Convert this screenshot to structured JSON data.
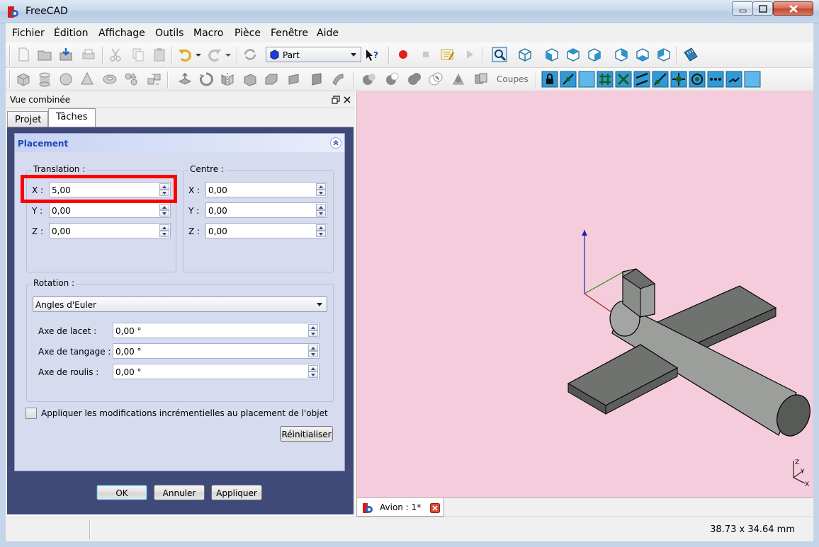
{
  "window": {
    "title": "FreeCAD",
    "icon": "freecad-gear-icon"
  },
  "menu": [
    "Fichier",
    "Édition",
    "Affichage",
    "Outils",
    "Macro",
    "Pièce",
    "Fenêtre",
    "Aide"
  ],
  "toolbar": {
    "workbench_selected": "Part",
    "sections_label": "Coupes"
  },
  "panel": {
    "title": "Vue combinée",
    "tabs": [
      "Projet",
      "Tâches"
    ],
    "active_tab": "Tâches"
  },
  "placement": {
    "title": "Placement",
    "translation": {
      "title": "Translation :",
      "x_label": "X :",
      "x_value": "5,00",
      "y_label": "Y :",
      "y_value": "0,00",
      "z_label": "Z :",
      "z_value": "0,00"
    },
    "centre": {
      "title": "Centre :",
      "x_label": "X :",
      "x_value": "0,00",
      "y_label": "Y :",
      "y_value": "0,00",
      "z_label": "Z :",
      "z_value": "0,00"
    },
    "rotation": {
      "title": "Rotation :",
      "mode": "Angles d'Euler",
      "yaw_label": "Axe de lacet :",
      "yaw_value": "0,00 °",
      "pitch_label": "Axe de tangage :",
      "pitch_value": "0,00 °",
      "roll_label": "Axe de roulis :",
      "roll_value": "0,00 °"
    },
    "incremental_label": "Appliquer les modifications incrémentielles au placement de l'objet",
    "incremental_checked": false,
    "reset_label": "Réinitialiser"
  },
  "dialog_buttons": {
    "ok": "OK",
    "cancel": "Annuler",
    "apply": "Appliquer"
  },
  "view": {
    "background": "#f5ccdb",
    "document_tab": "Avion : 1*",
    "axis_labels": [
      "Z",
      "Y",
      "X"
    ]
  },
  "status": {
    "dimensions": "38.73 x 34.64 mm"
  },
  "colors": {
    "highlight": "#ff0000",
    "task_bg": "#3f4a79",
    "placement_title": "#1c46b4"
  }
}
